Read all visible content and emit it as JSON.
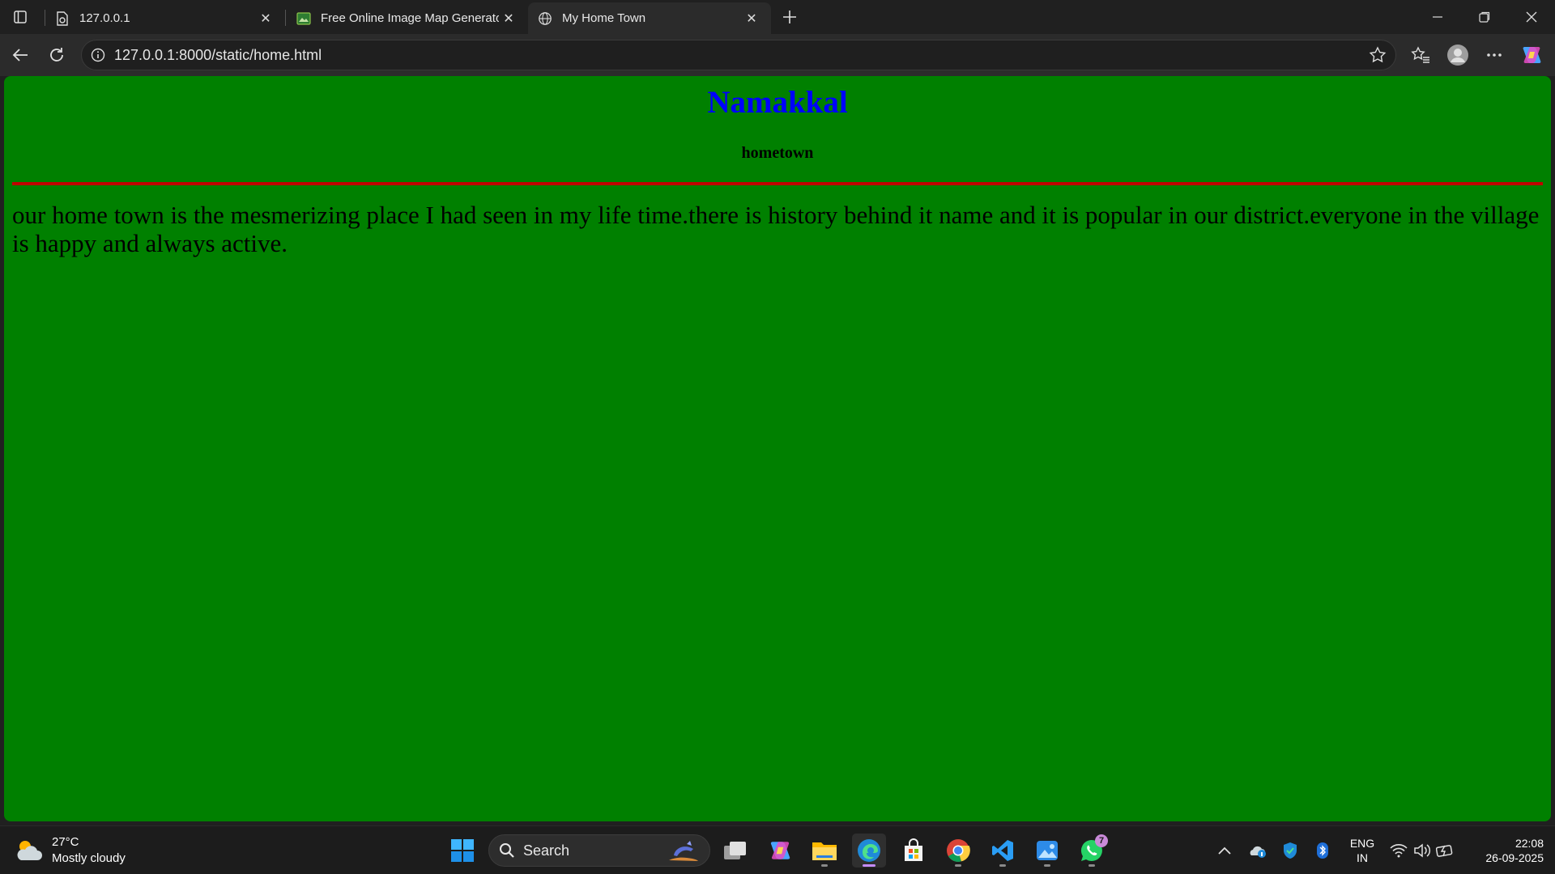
{
  "browser": {
    "tabs": [
      {
        "title": "127.0.0.1",
        "close": "✕"
      },
      {
        "title": "Free Online Image Map Generator",
        "close": "✕"
      },
      {
        "title": "My Home Town",
        "close": "✕"
      }
    ],
    "new_tab_icon": "plus-icon",
    "window_controls": [
      "minimize-icon",
      "restore-icon",
      "close-icon"
    ],
    "address_bar": {
      "url": "127.0.0.1:8000/static/home.html"
    },
    "toolbar_icons": [
      "back-icon",
      "reload-icon",
      "info-icon",
      "favorite-star-icon",
      "favorites-icon",
      "profile-icon",
      "more-icon",
      "copilot-icon"
    ]
  },
  "page": {
    "heading": "Namakkal",
    "subheading": "hometown",
    "paragraph": "our home town is the mesmerizing place I had seen in my life time.there is history behind it name and it is popular in our district.everyone in the village is happy and always active.",
    "colors": {
      "background": "#008000",
      "heading": "#0000ff",
      "rule": "#c00000"
    }
  },
  "taskbar": {
    "weather": {
      "temperature": "27°C",
      "condition": "Mostly cloudy"
    },
    "search_label": "Search",
    "pinned": [
      "start-icon",
      "search",
      "task-view-icon",
      "copilot-icon",
      "file-explorer-icon",
      "edge-icon",
      "microsoft-store-icon",
      "chrome-icon",
      "vscode-icon",
      "photos-icon",
      "whatsapp-icon"
    ],
    "whatsapp_badge": "7",
    "tray": {
      "language_top": "ENG",
      "language_bottom": "IN"
    },
    "clock": {
      "time": "22:08",
      "date": "26-09-2025"
    }
  }
}
